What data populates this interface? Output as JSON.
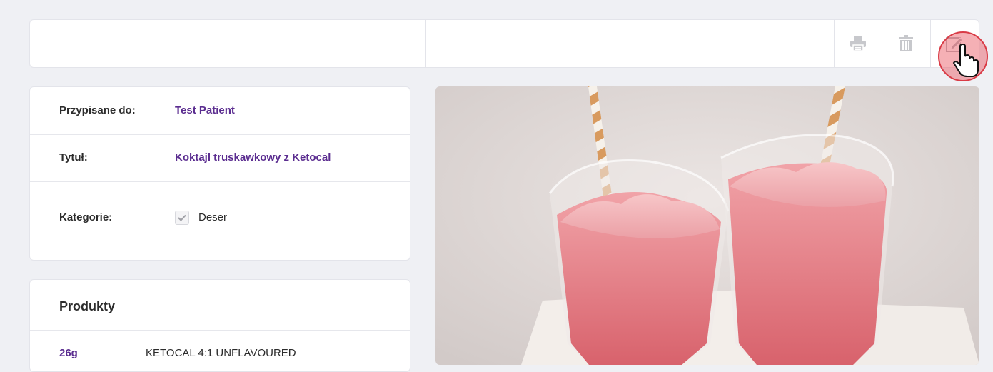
{
  "toolbar": {
    "buttons": [
      {
        "name": "print-icon"
      },
      {
        "name": "trash-icon"
      },
      {
        "name": "edit-icon"
      }
    ]
  },
  "details": {
    "assigned_label": "Przypisane do:",
    "assigned_value": "Test Patient",
    "title_label": "Tytuł:",
    "title_value": "Koktajl truskawkowy z Ketocal",
    "category_label": "Kategorie:",
    "category_value": "Deser",
    "category_checked": true
  },
  "products": {
    "heading": "Produkty",
    "items": [
      {
        "amount": "26g",
        "name": "KETOCAL 4:1 UNFLAVOURED"
      }
    ]
  },
  "colors": {
    "accent": "#5b2d90",
    "background": "#eff0f4",
    "card": "#ffffff",
    "cursor_highlight": "#e8505b"
  },
  "image": {
    "subject": "strawberry-smoothie-photo"
  }
}
